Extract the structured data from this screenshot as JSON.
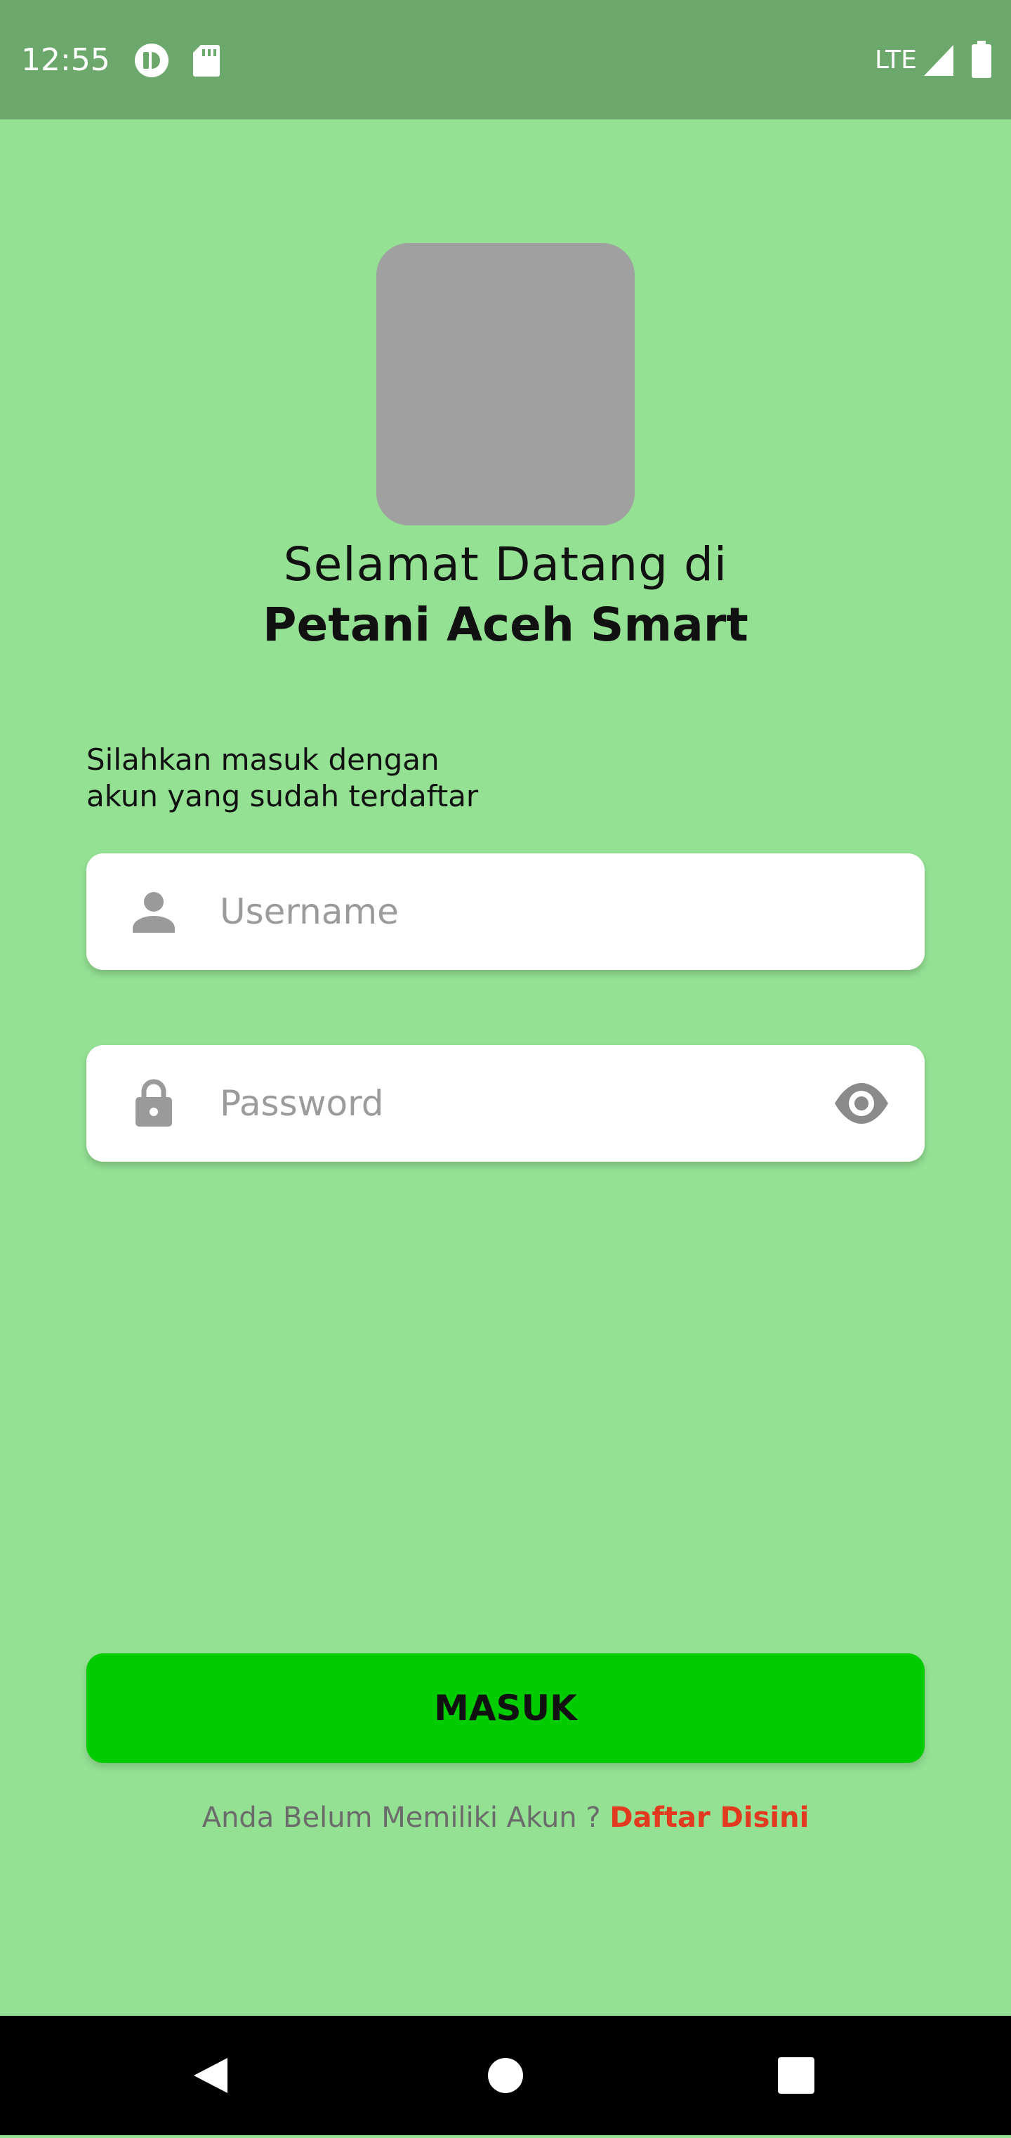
{
  "status_bar": {
    "time": "12:55",
    "network": "LTE",
    "icons": [
      "circle-app-icon",
      "sd-card-icon",
      "signal-icon",
      "battery-icon"
    ]
  },
  "header": {
    "welcome": "Selamat Datang di",
    "app_name": "Petani Aceh Smart"
  },
  "instruction": {
    "line1": "Silahkan masuk dengan",
    "line2": "akun yang sudah terdaftar"
  },
  "form": {
    "username": {
      "placeholder": "Username",
      "value": "",
      "icon": "person-icon"
    },
    "password": {
      "placeholder": "Password",
      "value": "",
      "icon": "lock-icon",
      "toggle_icon": "eye-icon"
    }
  },
  "actions": {
    "login_label": "MASUK",
    "register_prompt": "Anda Belum Memiliki Akun ?",
    "register_link": "Daftar Disini"
  },
  "nav": {
    "icons": [
      "back-icon",
      "home-icon",
      "recents-icon"
    ]
  },
  "colors": {
    "background": "#94e194",
    "status_bar": "#6ca86c",
    "button": "#00cc00",
    "link": "#e23a1f",
    "logo_placeholder": "#a0a0a0"
  }
}
